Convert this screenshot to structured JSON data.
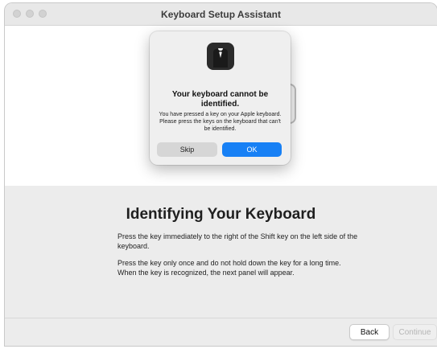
{
  "window": {
    "title": "Keyboard Setup Assistant"
  },
  "main": {
    "heading": "Identifying Your Keyboard",
    "paragraph1": "Press the key immediately to the right of the Shift key on the left side of the keyboard.",
    "paragraph2": "Press the key only once and do not hold down the key for a long time. When the key is recognized, the next panel will appear."
  },
  "footer": {
    "back_label": "Back",
    "continue_label": "Continue"
  },
  "alert": {
    "icon": "tuxedo-butler-icon",
    "title": "Your keyboard cannot be identified.",
    "message": "You have pressed a key on your Apple keyboard. Please press the keys on the keyboard that can't be identified.",
    "skip_label": "Skip",
    "ok_label": "OK"
  },
  "colors": {
    "accent": "#1780f5",
    "window_bg": "#ececec"
  }
}
